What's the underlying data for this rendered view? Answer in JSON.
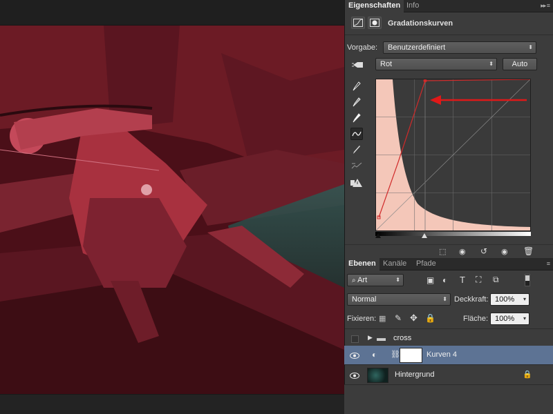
{
  "canvas": {
    "description_icons": []
  },
  "properties": {
    "tabs": [
      {
        "label": "Eigenschaften"
      },
      {
        "label": "Info"
      }
    ],
    "adjustment_title": "Gradationskurven",
    "preset_label": "Vorgabe:",
    "preset_value": "Benutzerdefiniert",
    "channel_value": "Rot",
    "auto_label": "Auto"
  },
  "layers": {
    "tabs": [
      {
        "label": "Ebenen"
      },
      {
        "label": "Kanäle"
      },
      {
        "label": "Pfade"
      }
    ],
    "filter_value": "Art",
    "blend_mode": "Normal",
    "opacity_label": "Deckkraft:",
    "opacity_value": "100%",
    "lock_label": "Fixieren:",
    "fill_label": "Fläche:",
    "fill_value": "100%",
    "items": [
      {
        "name": "cross"
      },
      {
        "name": "Kurven 4"
      },
      {
        "name": "Hintergrund"
      }
    ]
  },
  "colors": {
    "accent": "#5d7394",
    "curve": "#e03030"
  }
}
